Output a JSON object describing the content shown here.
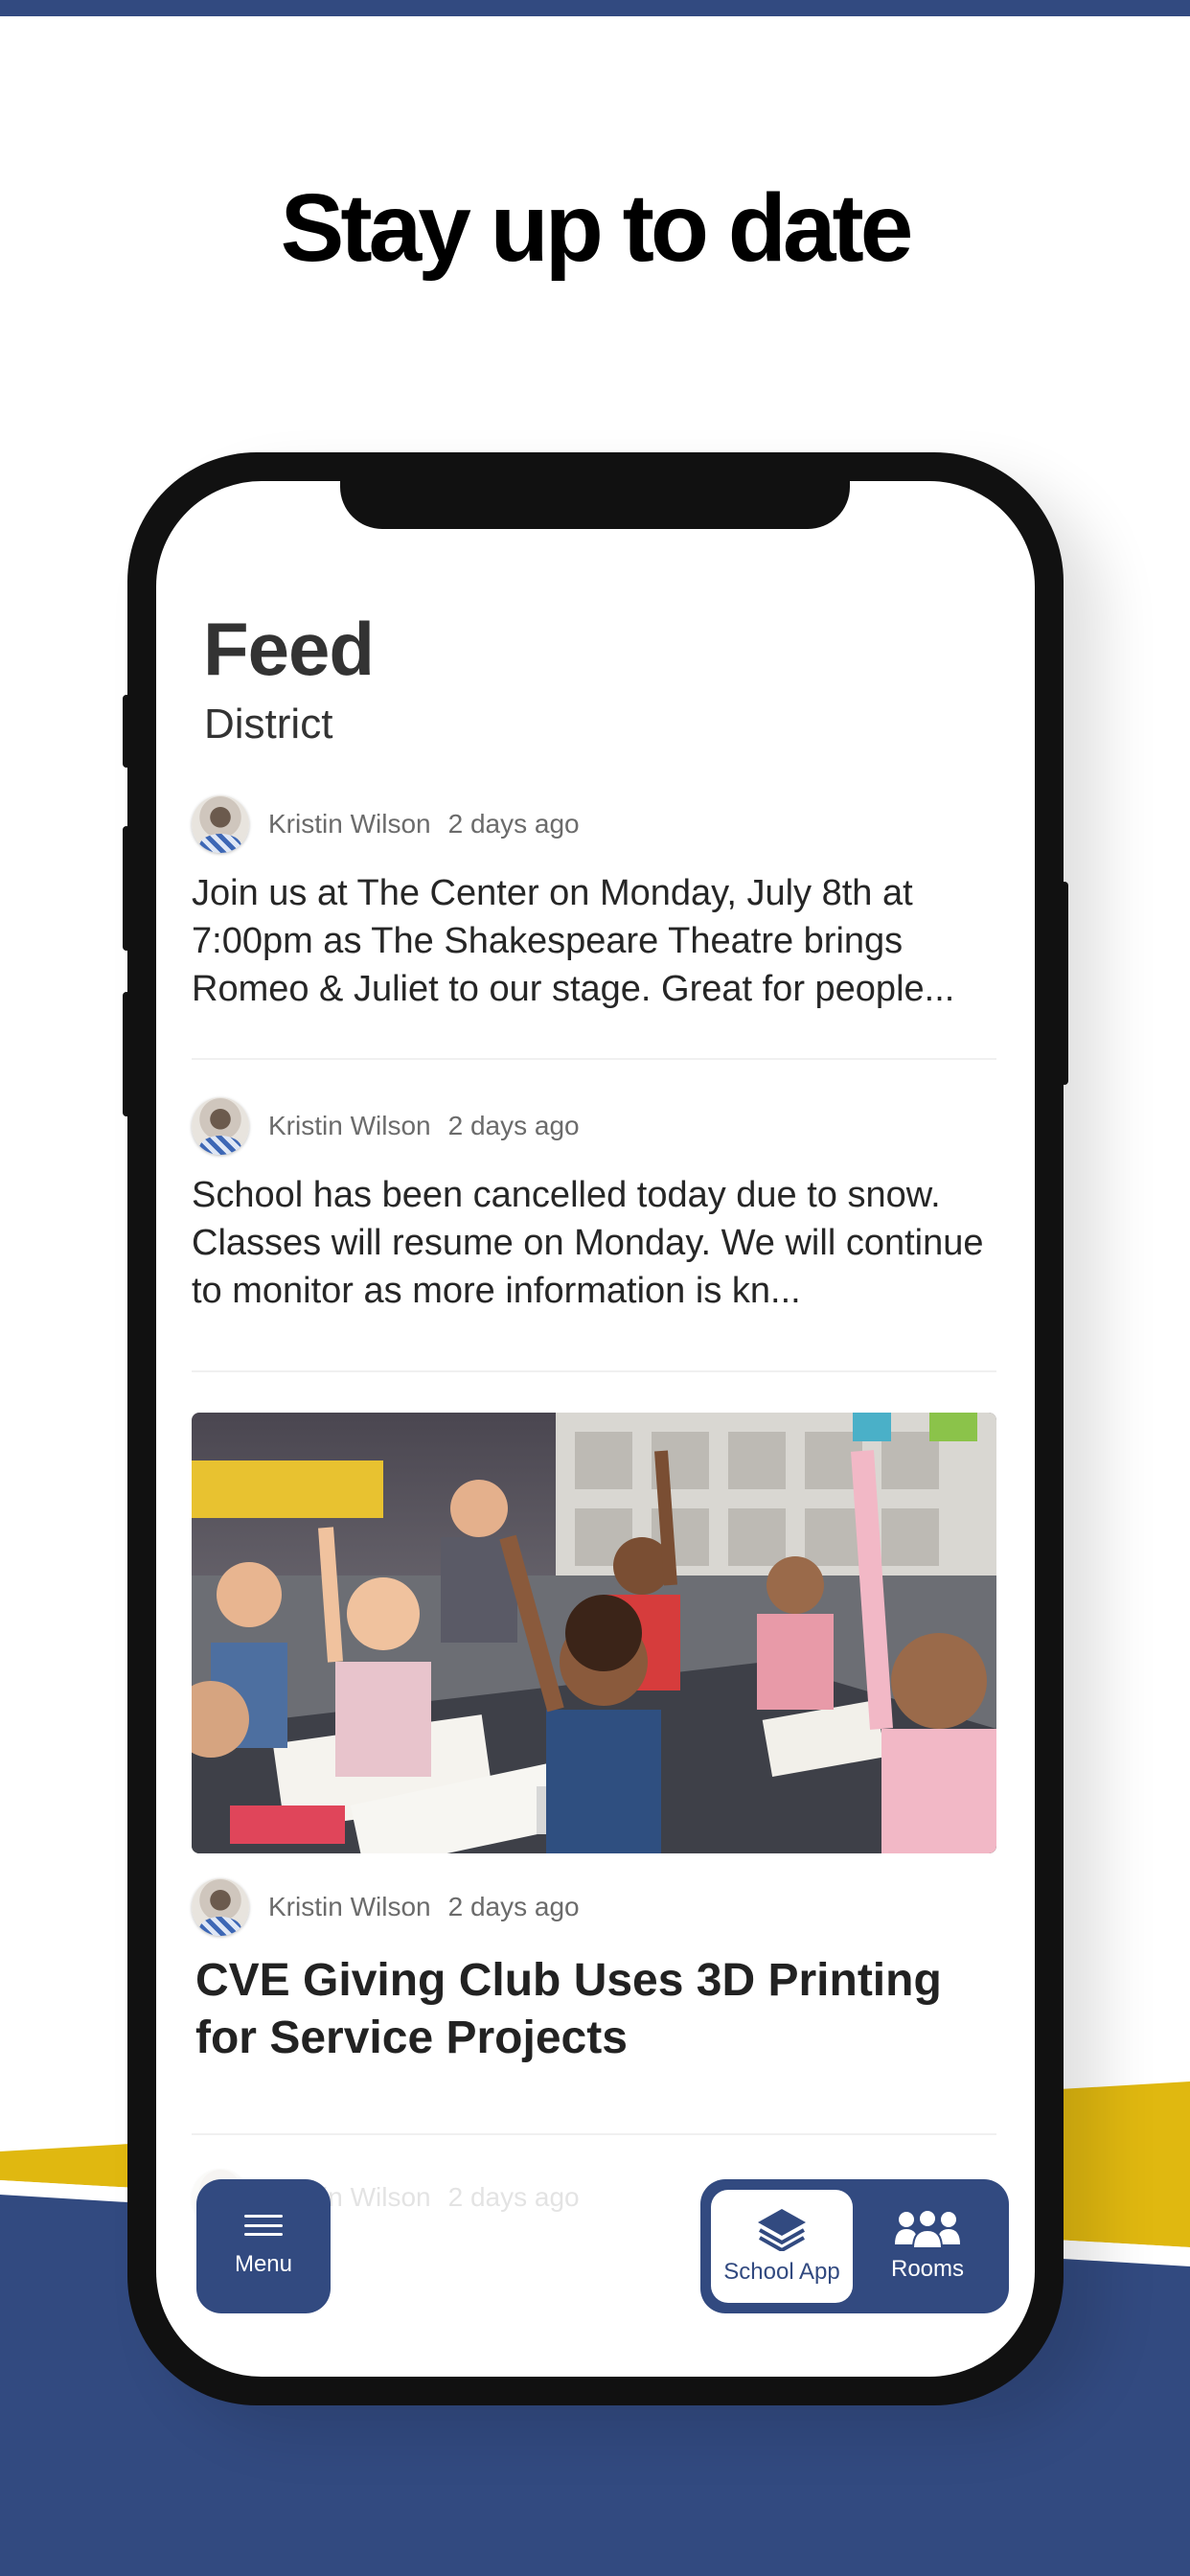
{
  "colors": {
    "brand_blue": "#324a80",
    "accent_yellow": "#e0b810",
    "frame": "#111111",
    "text_dark": "#262626",
    "text_meta": "#6b6b6b"
  },
  "marketing": {
    "headline": "Stay up to date"
  },
  "feed": {
    "title": "Feed",
    "subtitle": "District",
    "posts": [
      {
        "author": "Kristin Wilson",
        "time": "2 days ago",
        "body": "Join us at The Center on Monday, July 8th at 7:00pm as The Shakespeare Theatre brings Romeo & Juliet to our stage. Great for people..."
      },
      {
        "author": "Kristin Wilson",
        "time": "2 days ago",
        "body": "School has been cancelled today due to snow. Classes will resume on Monday. We will continue to monitor as more information is kn..."
      },
      {
        "image": "classroom-photo",
        "image_alt": "Children in a classroom raising their hands",
        "author": "Kristin Wilson",
        "time": "2 days ago",
        "title": "CVE Giving Club Uses 3D Printing for Service Projects"
      },
      {
        "author": "Kristin Wilson",
        "time": "2 days ago"
      }
    ]
  },
  "nav": {
    "menu": {
      "label": "Menu",
      "icon": "hamburger-icon"
    },
    "tabs": [
      {
        "label": "School App",
        "icon": "layers-icon",
        "active": true
      },
      {
        "label": "Rooms",
        "icon": "people-group-icon",
        "active": false
      }
    ]
  }
}
